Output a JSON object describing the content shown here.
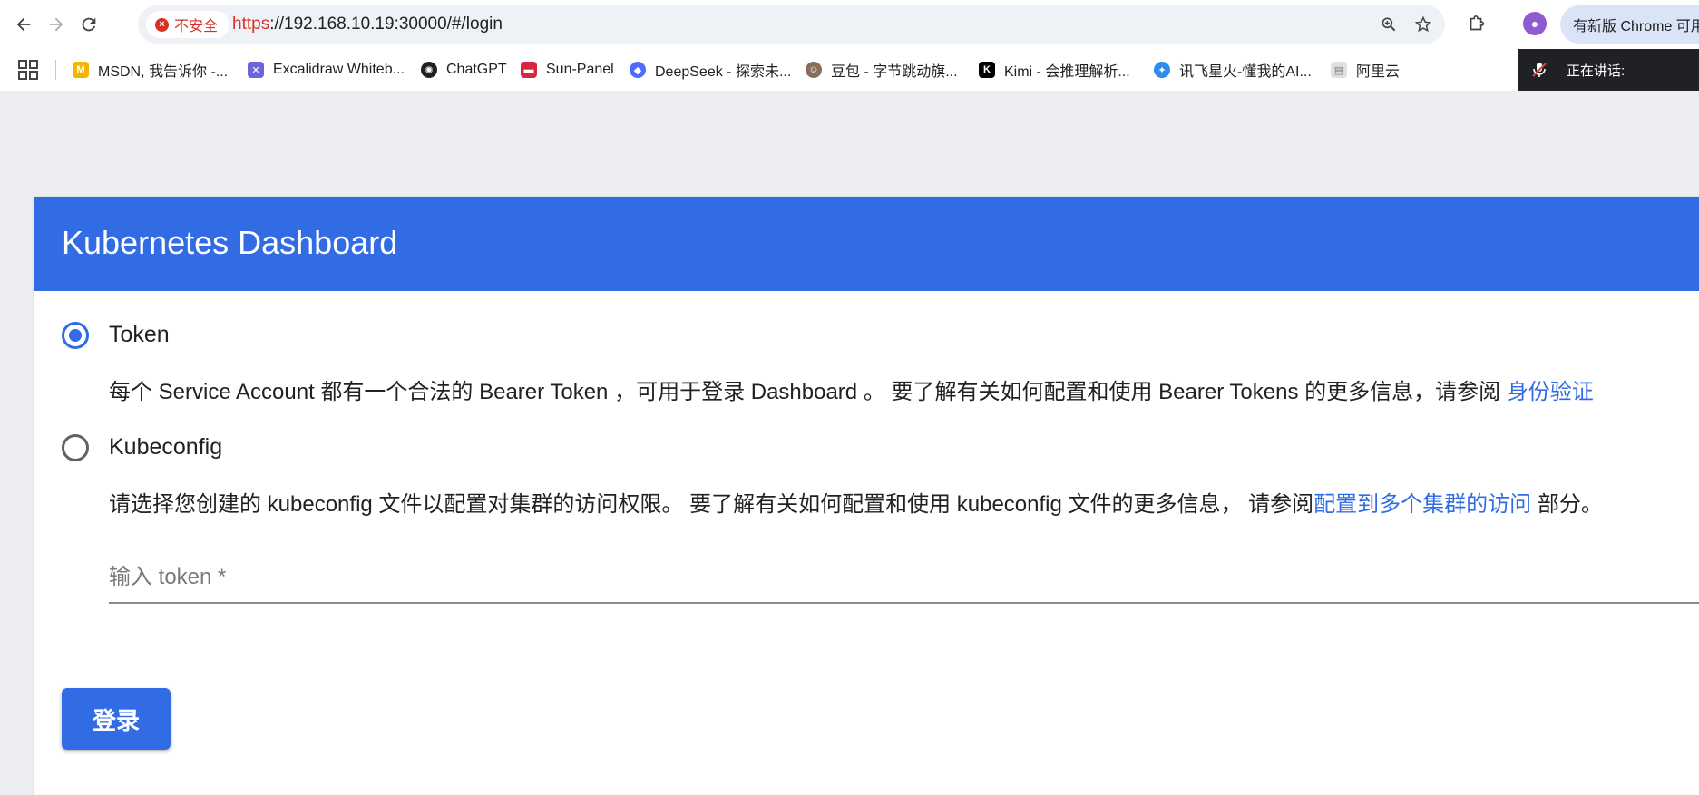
{
  "browser": {
    "security_label": "不安全",
    "url_scheme": "https",
    "url_rest": "://192.168.10.19:30000/#/login",
    "update_label": "有新版 Chrome 可用",
    "speaking_label": "正在讲话:"
  },
  "bookmarks": [
    {
      "label": "MSDN, 我告诉你 -...",
      "color": "#f4b400"
    },
    {
      "label": "Excalidraw Whiteb...",
      "color": "#6965db"
    },
    {
      "label": "ChatGPT",
      "color": "#202124"
    },
    {
      "label": "Sun-Panel",
      "color": "#d7263d"
    },
    {
      "label": "DeepSeek - 探索未...",
      "color": "#4d6bfe"
    },
    {
      "label": "豆包 - 字节跳动旗...",
      "color": "#8a6d5b"
    },
    {
      "label": "Kimi - 会推理解析...",
      "color": "#000000"
    },
    {
      "label": "讯飞星火-懂我的AI...",
      "color": "#2d8cf0"
    },
    {
      "label": "阿里云",
      "color": "#bdbdbd"
    }
  ],
  "page": {
    "title": "Kubernetes Dashboard",
    "options": {
      "token_label": "Token",
      "token_desc": "每个 Service Account 都有一个合法的 Bearer Token ，可用于登录 Dashboard 。 要了解有关如何配置和使用 Bearer Tokens 的更多信息，请参阅 ",
      "token_link": "身份验证",
      "kubeconfig_label": "Kubeconfig",
      "kubeconfig_desc": "请选择您创建的 kubeconfig 文件以配置对集群的访问权限。 要了解有关如何配置和使用 kubeconfig 文件的更多信息， 请参阅",
      "kubeconfig_link": "配置到多个集群的访问",
      "kubeconfig_tail": " 部分。"
    },
    "token_placeholder": "输入 token *",
    "login_label": "登录"
  },
  "colors": {
    "brand": "#326ce5",
    "insecure": "#d93025"
  }
}
